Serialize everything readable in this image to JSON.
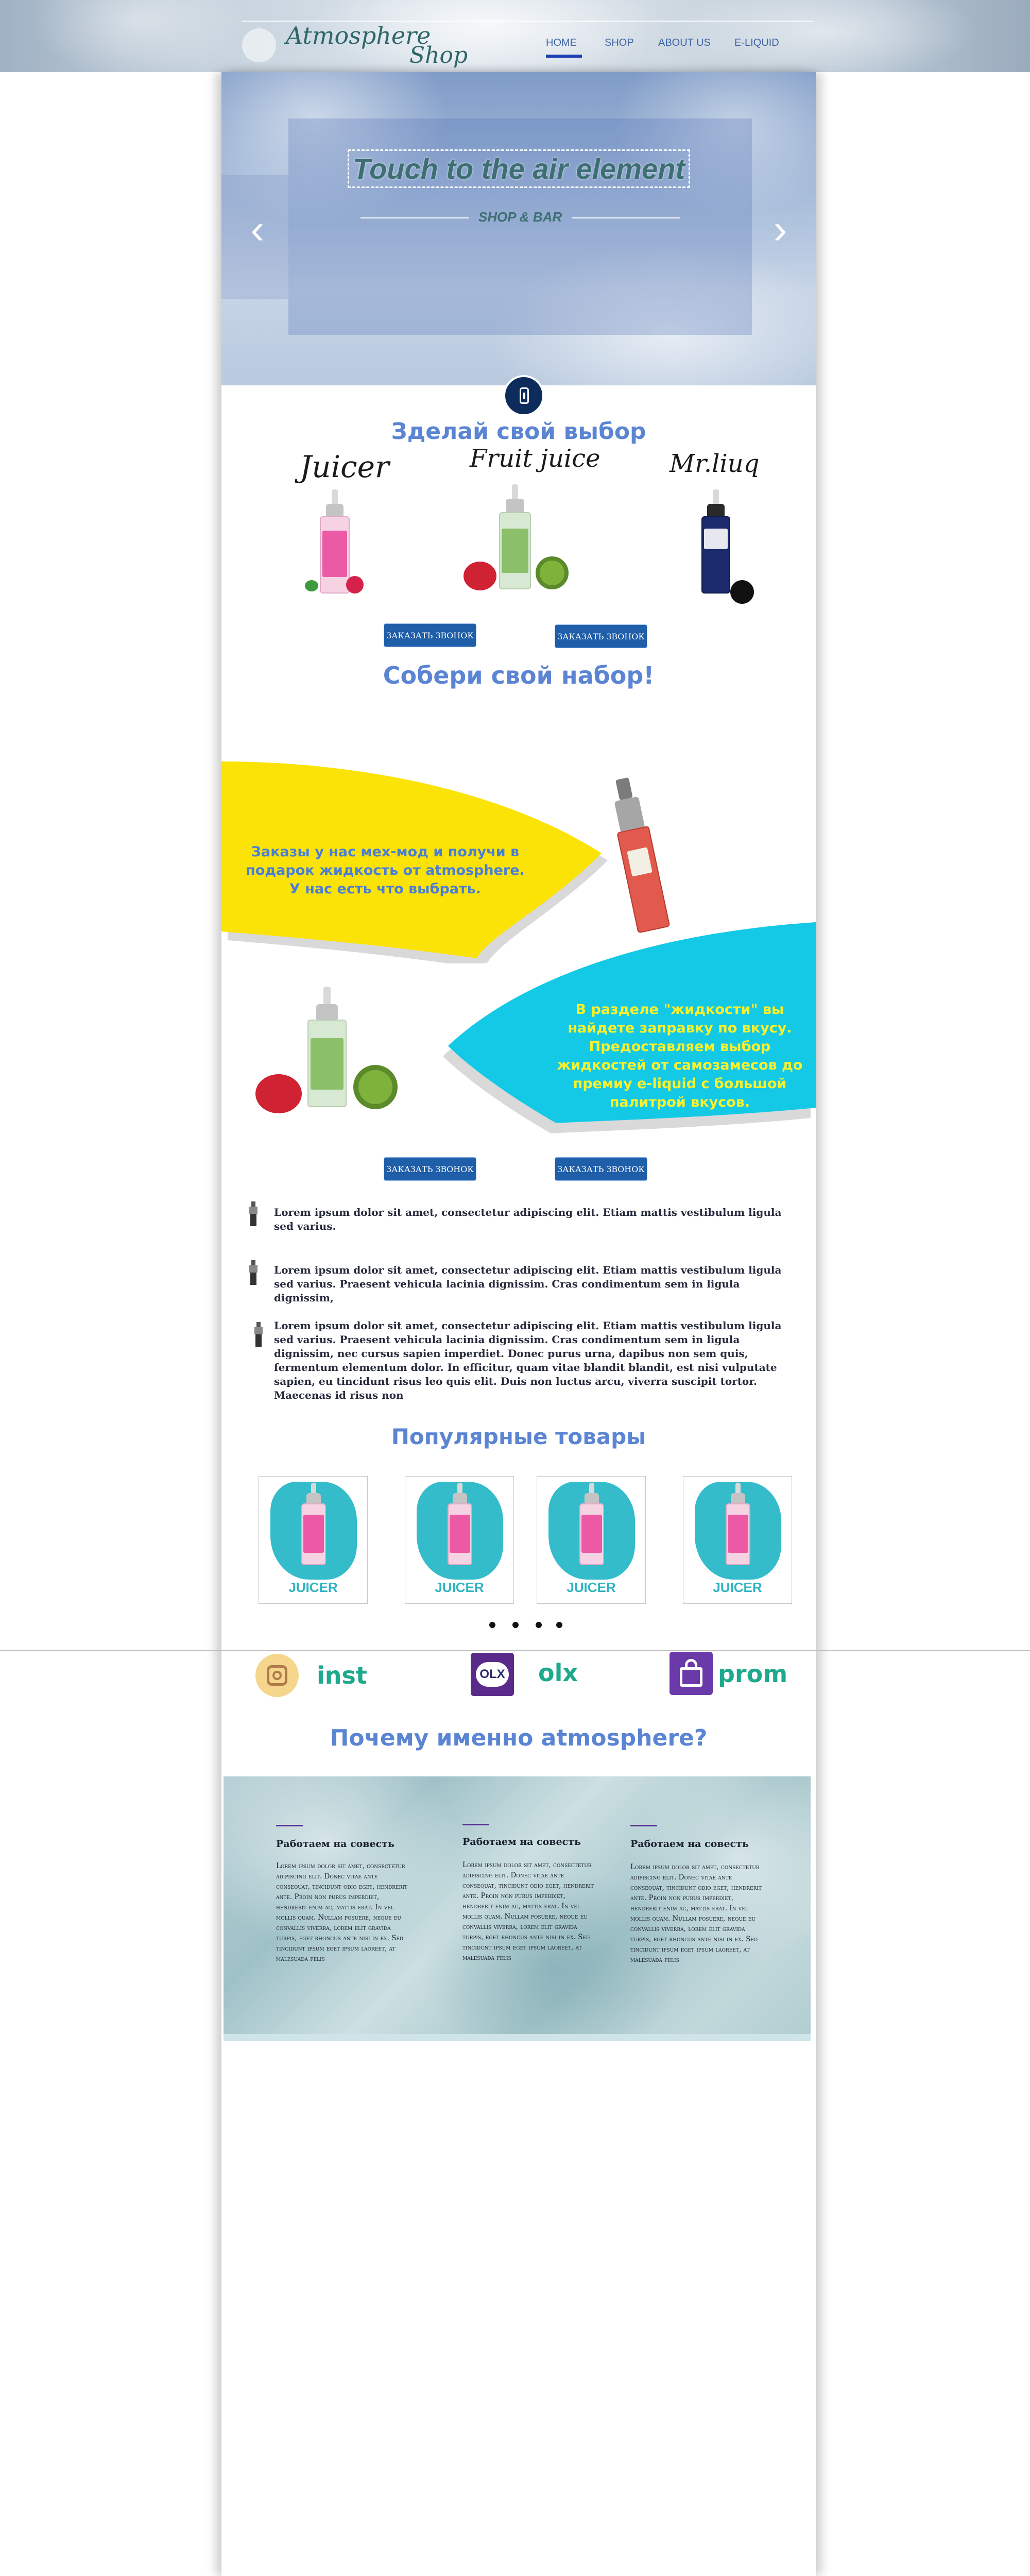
{
  "header": {
    "logo_line1": "Atmosphere",
    "logo_line2": "Shop",
    "nav": [
      {
        "label": "HOME",
        "active": true
      },
      {
        "label": "SHOP",
        "active": false
      },
      {
        "label": "ABOUT US",
        "active": false
      },
      {
        "label": "E-LIQUID",
        "active": false
      }
    ]
  },
  "hero": {
    "title": "Touch to the air element",
    "subtitle": "SHOP & BAR",
    "prev_icon": "chevron-left-icon",
    "next_icon": "chevron-right-icon",
    "badge_icon": "vape-device-icon"
  },
  "choice": {
    "heading": "Зделай свой выбор",
    "brands": [
      "Juicer",
      "Fruit juice",
      "Mr.liuq"
    ],
    "buttons": [
      "ЗАКАЗАТЬ ЗВОНОК",
      "ЗАКАЗАТЬ ЗВОНОК"
    ]
  },
  "kit": {
    "heading": "Собери свой набор!",
    "promo1": "Заказы у нас мех-мод и получи в подарок жидкость от atmosphere. У нас есть что выбрать.",
    "promo2": "В разделе \"жидкости\" вы найдете заправку по вкусу. Предоставляем выбор жидкостей от самозамесов до премиу e-liquid с большой палитрой вкусов.",
    "buttons": [
      "ЗАКАЗАТЬ ЗВОНОК",
      "ЗАКАЗАТЬ ЗВОНОК"
    ],
    "colors": {
      "yellow": "#fbe308",
      "cyan": "#14c9e6",
      "blue_text": "#4a7fd2",
      "yellow_text": "#f8f12b"
    }
  },
  "features": [
    "Lorem ipsum dolor sit amet, consectetur adipiscing elit. Etiam mattis vestibulum ligula sed varius.",
    "Lorem ipsum dolor sit amet, consectetur adipiscing elit. Etiam mattis vestibulum ligula sed varius. Praesent vehicula lacinia dignissim. Cras condimentum sem in ligula dignissim,",
    "Lorem ipsum dolor sit amet, consectetur adipiscing elit. Etiam mattis vestibulum ligula sed varius. Praesent vehicula lacinia dignissim. Cras condimentum sem in ligula dignissim, nec cursus sapien imperdiet. Donec purus urna, dapibus non sem quis, fermentum elementum dolor. In efficitur, quam vitae blandit blandit, est nisi vulputate sapien, eu tincidunt risus leo quis elit. Duis non luctus arcu, viverra suscipit tortor. Maecenas id risus non"
  ],
  "popular": {
    "heading": "Популярные товары",
    "cards": [
      "JUICER",
      "JUICER",
      "JUICER",
      "JUICER"
    ],
    "dots": 4
  },
  "socials": [
    {
      "label": "inst",
      "icon": "instagram-icon"
    },
    {
      "label": "olx",
      "icon": "olx-icon"
    },
    {
      "label": "prom",
      "icon": "prom-bag-icon"
    }
  ],
  "why": {
    "heading": "Почему именно atmosphere?",
    "columns": [
      {
        "title": "Работаем на совесть",
        "text": "Lorem ipsum dolor sit amet, consectetur adipiscing elit. Donec vitae ante consequat, tincidunt odio eget, hendrerit ante. Proin non purus imperdiet, hendrerit enim ac, mattis erat. In vel mollis quam. Nullam posuere, neque eu convallis viverra, lorem elit gravida turpis, eget rhoncus ante nisi in ex. Sed tincidunt ipsum eget ipsum laoreet, at malesuada felis"
      },
      {
        "title": "Работаем на совесть",
        "text": "Lorem ipsum dolor sit amet, consectetur adipiscing elit. Donec vitae ante consequat, tincidunt odio eget, hendrerit ante. Proin non purus imperdiet, hendrerit enim ac, mattis erat. In vel mollis quam. Nullam posuere, neque eu convallis viverra, lorem elit gravida turpis, eget rhoncus ante nisi in ex. Sed tincidunt ipsum eget ipsum laoreet, at malesuada felis"
      },
      {
        "title": "Работаем на совесть",
        "text": "Lorem ipsum dolor sit amet, consectetur adipiscing elit. Donec vitae ante consequat, tincidunt odio eget, hendrerit ante. Proin non purus imperdiet, hendrerit enim ac, mattis erat. In vel mollis quam. Nullam posuere, neque eu convallis viverra, lorem elit gravida turpis, eget rhoncus ante nisi in ex. Sed tincidunt ipsum eget ipsum laoreet, at malesuada felis"
      }
    ]
  }
}
